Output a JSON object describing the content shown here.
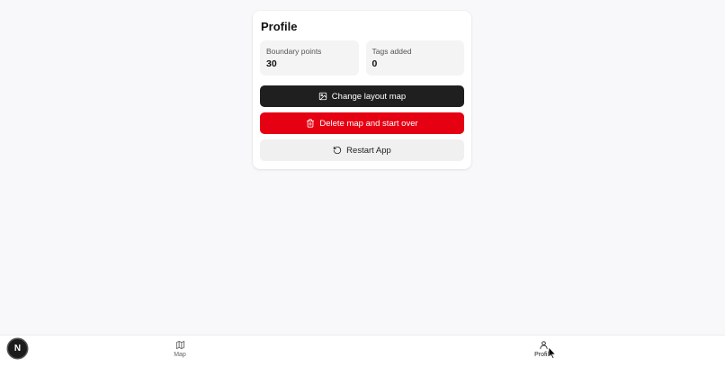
{
  "profile": {
    "title": "Profile",
    "stats": [
      {
        "label": "Boundary points",
        "value": "30"
      },
      {
        "label": "Tags added",
        "value": "0"
      }
    ],
    "buttons": {
      "change_layout": "Change layout map",
      "delete_map": "Delete map and start over",
      "restart_app": "Restart App"
    }
  },
  "nav": {
    "logo": "N",
    "items": [
      {
        "label": "Map",
        "icon": "map-icon",
        "active": false
      },
      {
        "label": "Profile",
        "icon": "user-icon",
        "active": true
      }
    ]
  },
  "colors": {
    "background": "#f8f8fa",
    "dark_button": "#1f1f1f",
    "danger_button": "#e50012",
    "light_button": "#f0f0f1"
  }
}
